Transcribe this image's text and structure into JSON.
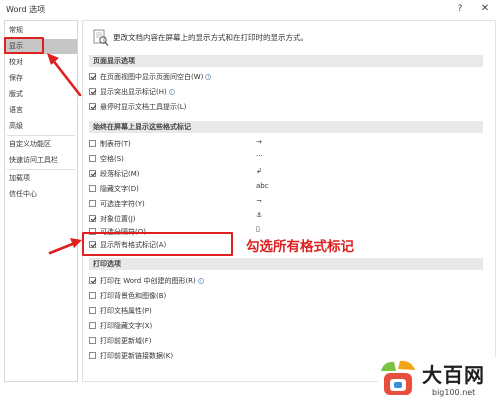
{
  "window": {
    "title": "Word 选项",
    "help_glyph": "?",
    "close_glyph": "✕"
  },
  "sidebar": {
    "items": [
      {
        "label": "常规"
      },
      {
        "label": "显示"
      },
      {
        "label": "校对"
      },
      {
        "label": "保存"
      },
      {
        "label": "版式"
      },
      {
        "label": "语言"
      },
      {
        "label": "高级"
      },
      {
        "label": "自定义功能区"
      },
      {
        "label": "快速访问工具栏"
      },
      {
        "label": "加载项"
      },
      {
        "label": "信任中心"
      }
    ],
    "selected": "显示"
  },
  "main": {
    "intro": "更改文档内容在屏幕上的显示方式和在打印时的显示方式。",
    "page_display": {
      "header": "页面显示选项",
      "options": [
        {
          "label": "在页面视图中显示页面间空白(W)",
          "checked": true,
          "info": true
        },
        {
          "label": "显示突出显示标记(H)",
          "checked": true,
          "info": true
        },
        {
          "label": "悬停时显示文档工具提示(L)",
          "checked": true,
          "info": false
        }
      ]
    },
    "formatting_marks": {
      "header": "始终在屏幕上显示这些格式标记",
      "options": [
        {
          "label": "制表符(T)",
          "checked": false,
          "symbol": "→"
        },
        {
          "label": "空格(S)",
          "checked": false,
          "symbol": "···"
        },
        {
          "label": "段落标记(M)",
          "checked": true,
          "symbol": "↲"
        },
        {
          "label": "隐藏文字(D)",
          "checked": false,
          "symbol": "abc"
        },
        {
          "label": "可选连字符(Y)",
          "checked": false,
          "symbol": "¬"
        },
        {
          "label": "对象位置(J)",
          "checked": true,
          "symbol": "⚓"
        },
        {
          "label": "可选分隔符(O)",
          "checked": false,
          "symbol": "▯"
        },
        {
          "label": "显示所有格式标记(A)",
          "checked": true,
          "symbol": ""
        }
      ]
    },
    "print": {
      "header": "打印选项",
      "options": [
        {
          "label": "打印在 Word 中创建的图形(R)",
          "checked": true,
          "info": true
        },
        {
          "label": "打印背景色和图像(B)",
          "checked": false,
          "info": false
        },
        {
          "label": "打印文档属性(P)",
          "checked": false,
          "info": false
        },
        {
          "label": "打印隐藏文字(X)",
          "checked": false,
          "info": false
        },
        {
          "label": "打印前更新域(F)",
          "checked": false,
          "info": false
        },
        {
          "label": "打印前更新链接数据(K)",
          "checked": false,
          "info": false
        }
      ]
    }
  },
  "annotation": {
    "text": "勾选所有格式标记",
    "color": "#e02020"
  },
  "watermark": {
    "title": "大百网",
    "url": "big100.net"
  }
}
